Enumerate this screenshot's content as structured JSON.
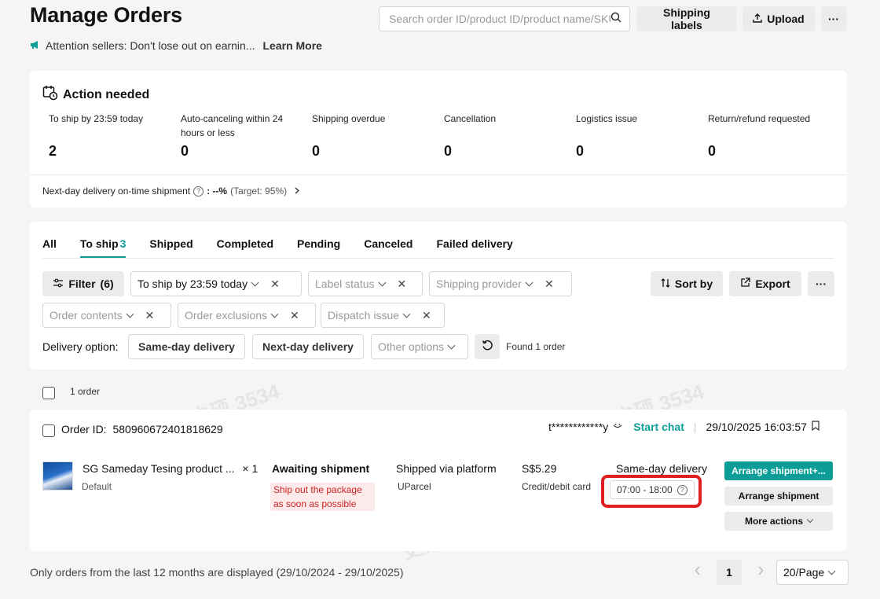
{
  "header": {
    "title": "Manage Orders",
    "search_placeholder": "Search order ID/product ID/product name/SKU",
    "shipping_labels": "Shipping labels",
    "upload": "Upload",
    "more": "···"
  },
  "notice": {
    "text": "Attention sellers: Don't lose out on earnin...",
    "link": "Learn More"
  },
  "action_needed": {
    "title": "Action needed",
    "metrics": [
      {
        "label": "To ship by 23:59 today",
        "value": "2"
      },
      {
        "label": "Auto-canceling within 24 hours or less",
        "value": "0"
      },
      {
        "label": "Shipping overdue",
        "value": "0"
      },
      {
        "label": "Cancellation",
        "value": "0"
      },
      {
        "label": "Logistics issue",
        "value": "0"
      },
      {
        "label": "Return/refund requested",
        "value": "0"
      }
    ],
    "nextday_label": "Next-day delivery on-time shipment",
    "nextday_value": ": --%",
    "nextday_target": "(Target: 95%)"
  },
  "tabs": [
    {
      "label": "All"
    },
    {
      "label": "To ship",
      "count": "3"
    },
    {
      "label": "Shipped"
    },
    {
      "label": "Completed"
    },
    {
      "label": "Pending"
    },
    {
      "label": "Canceled"
    },
    {
      "label": "Failed delivery"
    }
  ],
  "filters": {
    "filter_btn": "Filter",
    "filter_count": "(6)",
    "to_ship_select": "To ship by 23:59 today",
    "label_status": "Label status",
    "shipping_provider": "Shipping provider",
    "order_contents": "Order contents",
    "order_exclusions": "Order exclusions",
    "dispatch_issue": "Dispatch issue",
    "sort_by": "Sort by",
    "export": "Export",
    "more": "···",
    "delivery_label": "Delivery option:",
    "same_day": "Same-day delivery",
    "next_day": "Next-day delivery",
    "other_options": "Other options",
    "found": "Found 1 order"
  },
  "list": {
    "select_all_label": "1 order"
  },
  "order": {
    "id_label": "Order ID:",
    "id": "580960672401818629",
    "buyer": "t************y",
    "start_chat": "Start chat",
    "date": "29/10/2025 16:03:57",
    "product_name": "SG Sameday Tesing product ...",
    "qty": "× 1",
    "variant": "Default",
    "status": "Awaiting shipment",
    "warning": "Ship out the package as soon as possible",
    "shipping_method": "Shipped via platform",
    "carrier": "UParcel",
    "price": "S$5.29",
    "payment": "Credit/debit card",
    "delivery_type": "Same-day delivery",
    "time_window": "07:00 - 18:00",
    "arrange_plus": "Arrange shipment+...",
    "arrange": "Arrange shipment",
    "more_actions": "More actions"
  },
  "footer": {
    "note": "Only orders from the last 12 months are displayed (29/10/2024 - 29/10/2025)",
    "page": "1",
    "per_page": "20/Page"
  },
  "watermark": "史硕 3534",
  "colors": {
    "accent": "#0c9d99",
    "highlight": "#e02020",
    "warning_text": "#cc2222"
  }
}
